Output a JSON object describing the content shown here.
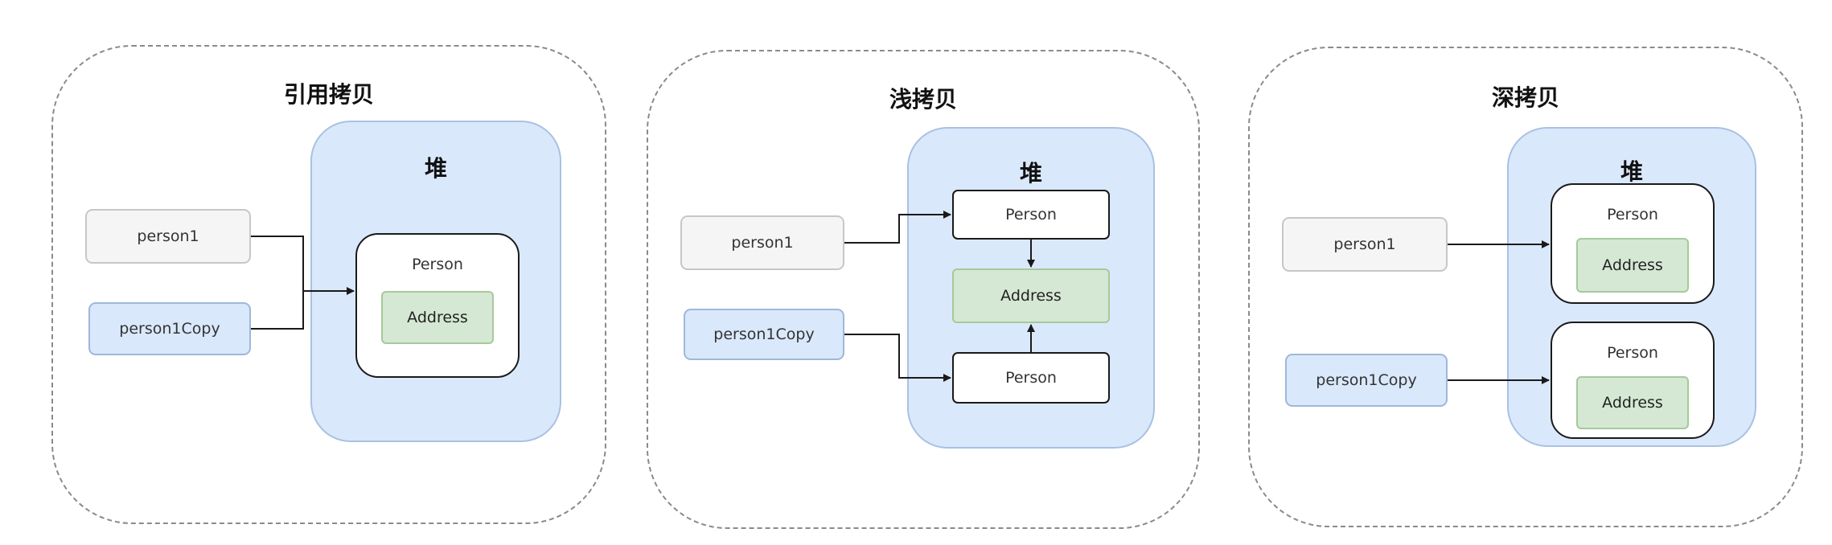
{
  "panels": [
    {
      "title": "引用拷贝",
      "heap_label": "堆",
      "var1": "person1",
      "var2": "person1Copy",
      "object": "Person",
      "field": "Address"
    },
    {
      "title": "浅拷贝",
      "heap_label": "堆",
      "var1": "person1",
      "var2": "person1Copy",
      "object1": "Person",
      "field": "Address",
      "object2": "Person"
    },
    {
      "title": "深拷贝",
      "heap_label": "堆",
      "var1": "person1",
      "var2": "person1Copy",
      "object1": "Person",
      "field1": "Address",
      "object2": "Person",
      "field2": "Address"
    }
  ]
}
